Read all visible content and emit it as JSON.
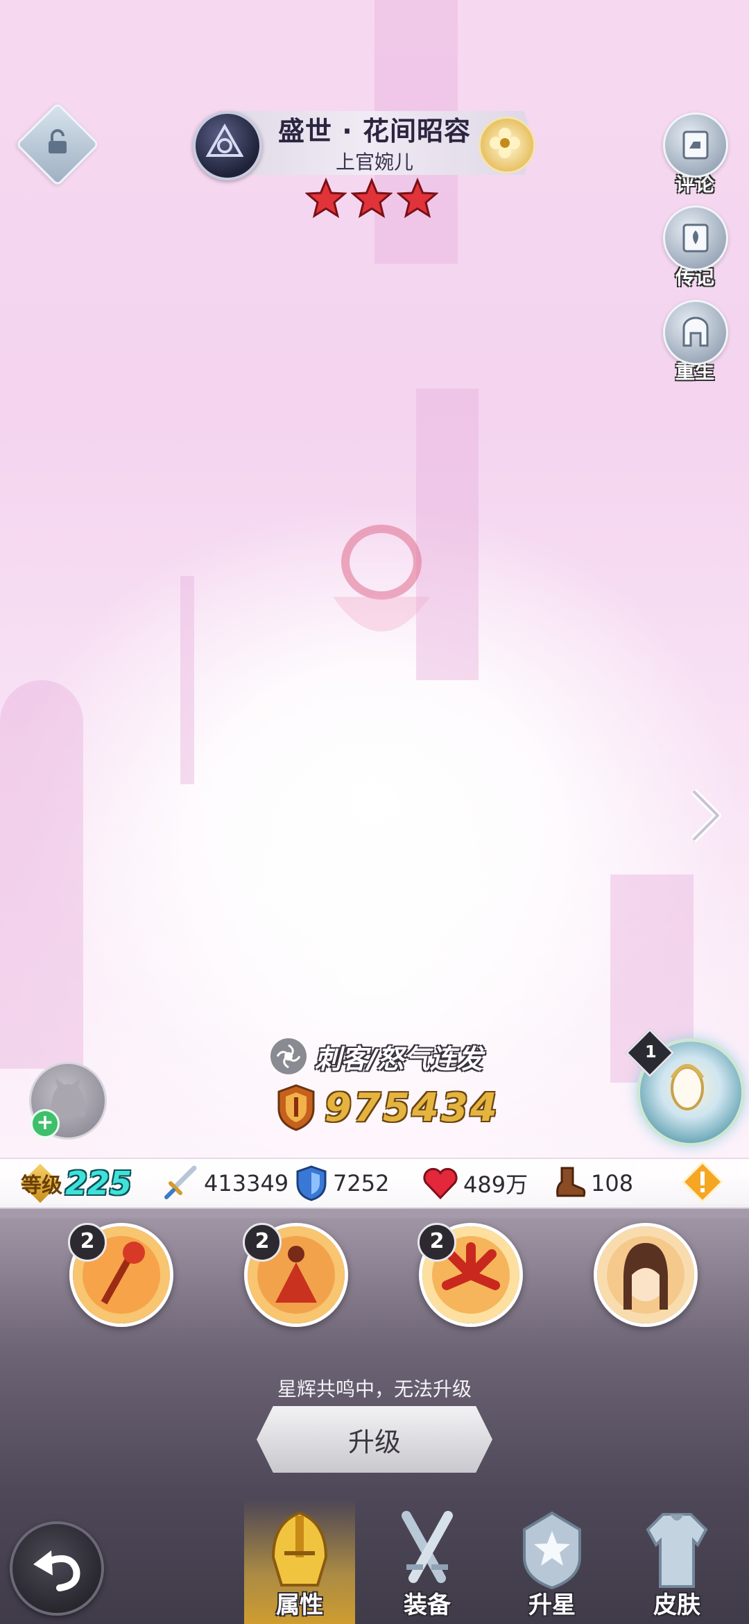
{
  "header": {
    "title": "盛世 · 花间昭容",
    "hero_name": "上官婉儿",
    "star_count": 3
  },
  "side_buttons": [
    {
      "label": "评论",
      "icon": "comment-book-icon"
    },
    {
      "label": "传记",
      "icon": "biography-book-icon"
    },
    {
      "label": "重生",
      "icon": "rebirth-gate-icon"
    }
  ],
  "hero": {
    "class_text": "刺客/怒气连发",
    "power": "975434"
  },
  "artifact": {
    "badge": "1"
  },
  "stats": {
    "level_label": "等级",
    "level_value": "225",
    "attack": "413349",
    "defense": "7252",
    "hp": "489万",
    "speed": "108"
  },
  "skills": [
    {
      "badge": "2",
      "icon": "flower-staff-skill-icon"
    },
    {
      "badge": "2",
      "icon": "dancer-skill-icon"
    },
    {
      "badge": "2",
      "icon": "red-lily-skill-icon"
    },
    {
      "badge": "",
      "icon": "hero-portrait-skill-icon"
    }
  ],
  "upgrade": {
    "hint": "星辉共鸣中，无法升级",
    "button_label": "升级"
  },
  "tabs": [
    {
      "label": "属性",
      "icon": "helmet-icon",
      "active": true
    },
    {
      "label": "装备",
      "icon": "swords-icon",
      "active": false
    },
    {
      "label": "升星",
      "icon": "star-shield-icon",
      "active": false
    },
    {
      "label": "皮肤",
      "icon": "armor-icon",
      "active": false
    }
  ],
  "colors": {
    "power_gold": "#e5b43f",
    "level_cyan": "#3fe2d8",
    "star_red": "#e0343a",
    "active_tab_glow": "#ffc83c"
  }
}
